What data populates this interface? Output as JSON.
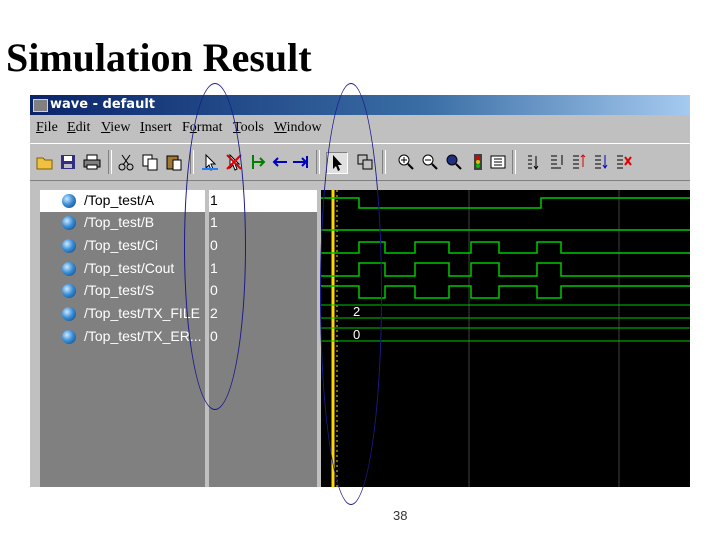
{
  "slide": {
    "title": "Simulation Result",
    "page_number": "38"
  },
  "window": {
    "title": "wave - default"
  },
  "menu": [
    {
      "pre": "",
      "ul": "F",
      "post": "ile"
    },
    {
      "pre": "",
      "ul": "E",
      "post": "dit"
    },
    {
      "pre": "",
      "ul": "V",
      "post": "iew"
    },
    {
      "pre": "",
      "ul": "I",
      "post": "nsert"
    },
    {
      "pre": "F",
      "ul": "o",
      "post": "rmat"
    },
    {
      "pre": "",
      "ul": "T",
      "post": "ools"
    },
    {
      "pre": "",
      "ul": "W",
      "post": "indow"
    }
  ],
  "toolbar_icons": [
    "open-folder",
    "save",
    "print",
    "cut",
    "copy",
    "paste",
    "select-pointer",
    "delete",
    "insert-cursor",
    "previous-edge",
    "next-edge",
    "pointer-arrow",
    "zoom-box",
    "zoom-in",
    "zoom-out",
    "zoom-full",
    "stop-run",
    "run-options",
    "find",
    "expand-bus",
    "collapse-bus",
    "sort-signals",
    "delete-signal"
  ],
  "signals": [
    {
      "name": "/Top_test/A",
      "value": "1"
    },
    {
      "name": "/Top_test/B",
      "value": "1"
    },
    {
      "name": "/Top_test/Ci",
      "value": "0"
    },
    {
      "name": "/Top_test/Cout",
      "value": "1"
    },
    {
      "name": "/Top_test/S",
      "value": "0"
    },
    {
      "name": "/Top_test/TX_FILE",
      "value": "2"
    },
    {
      "name": "/Top_test/TX_ER...",
      "value": "0"
    }
  ],
  "bus_labels": [
    "2",
    "0"
  ],
  "colors": {
    "waveform": "#00c800",
    "cursor": "#ffd700",
    "grid": "#404040",
    "annotation": "#1a1a8a"
  }
}
